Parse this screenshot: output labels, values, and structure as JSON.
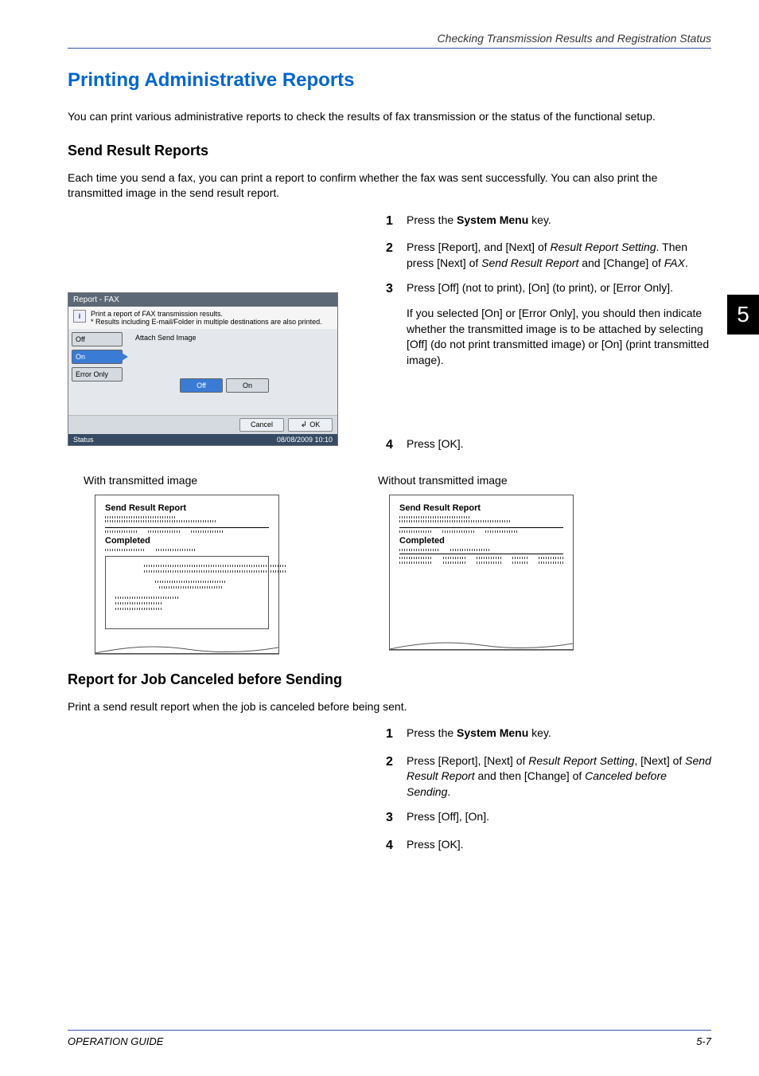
{
  "header": {
    "breadcrumb": "Checking Transmission Results and Registration Status"
  },
  "chapter": "5",
  "h1": "Printing Administrative Reports",
  "intro": "You can print various administrative reports to check the results of fax transmission or the status of the functional setup.",
  "sec1": {
    "heading": "Send Result Reports",
    "para": "Each time you send a fax, you can print a report to confirm whether the fax was sent successfully. You can also print the transmitted image in the send result report.",
    "steps": [
      {
        "n": "1",
        "parts": [
          "Press the ",
          "System Menu",
          " key."
        ]
      },
      {
        "n": "2",
        "parts": [
          "Press [Report], and [Next] of ",
          "Result Report Setting",
          ". Then press [Next] of ",
          "Send Result Report",
          " and [Change] of ",
          "FAX",
          "."
        ]
      },
      {
        "n": "3",
        "parts": [
          "Press [Off] (not to print), [On] (to print), or [Error Only]."
        ],
        "after": "If you selected [On] or [Error Only], you should then indicate whether the transmitted image is to be attached by selecting [Off] (do not print transmitted image) or [On] (print transmitted image)."
      },
      {
        "n": "4",
        "parts": [
          "Press [OK]."
        ]
      }
    ]
  },
  "panel": {
    "title": "Report - FAX",
    "info_line1": "Print a report of FAX transmission results.",
    "info_line2": "* Results including E-mail/Folder in multiple destinations are also printed.",
    "side": {
      "off": "Off",
      "on": "On",
      "err": "Error Only"
    },
    "attach_label": "Attach Send Image",
    "toggles": {
      "off": "Off",
      "on": "On"
    },
    "actions": {
      "cancel": "Cancel",
      "ok": "OK"
    },
    "status": {
      "label": "Status",
      "datetime": "08/08/2009   10:10"
    }
  },
  "samples": {
    "left_caption": "With transmitted image",
    "right_caption": "Without transmitted image",
    "report_title": "Send Result Report",
    "completed": "Completed"
  },
  "sec2": {
    "heading": "Report for Job Canceled before Sending",
    "para": "Print a send result report when the job is canceled before being sent.",
    "steps": [
      {
        "n": "1",
        "parts": [
          "Press the ",
          "System Menu",
          " key."
        ]
      },
      {
        "n": "2",
        "parts": [
          "Press [Report], [Next] of ",
          "Result Report Setting",
          ", [Next] of ",
          "Send Result Report",
          " and then [Change] of ",
          "Canceled before Sending",
          "."
        ]
      },
      {
        "n": "3",
        "parts": [
          "Press [Off], [On]."
        ]
      },
      {
        "n": "4",
        "parts": [
          "Press [OK]."
        ]
      }
    ]
  },
  "footer": {
    "left": "OPERATION GUIDE",
    "right": "5-7"
  }
}
